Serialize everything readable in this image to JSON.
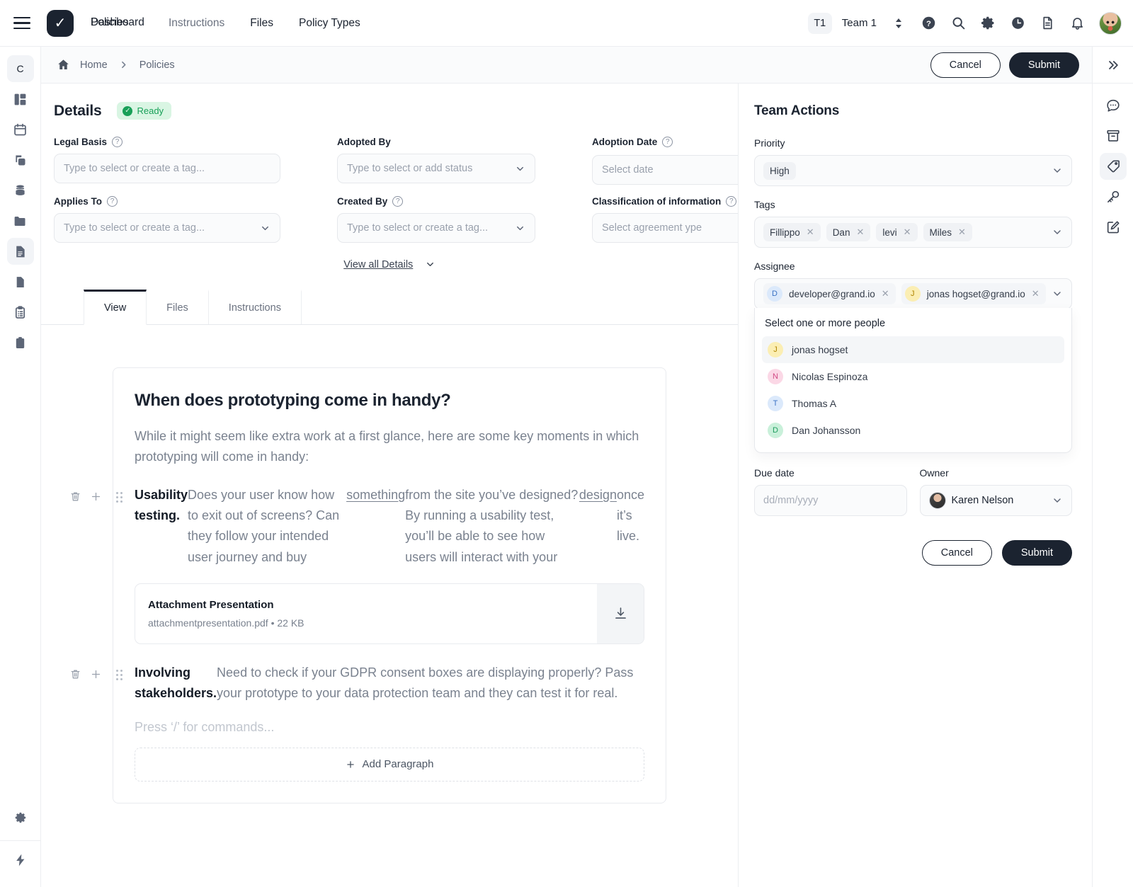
{
  "topbar": {
    "menu_icon": "hamburger-icon",
    "logo_icon": "check-logo",
    "nav": [
      {
        "label": "Dashboard",
        "id": "dashboard"
      },
      {
        "label": "Policies",
        "id": "policies"
      },
      {
        "label": "Instructions",
        "id": "instructions"
      },
      {
        "label": "Files",
        "id": "files"
      },
      {
        "label": "Policy Types",
        "id": "policy-types"
      }
    ],
    "team_badge": "T1",
    "team_name": "Team 1",
    "icons": [
      "updown-selector-icon",
      "help-icon",
      "search-icon",
      "gear-icon",
      "clock-icon",
      "document-icon",
      "bell-icon"
    ],
    "avatar": "user-avatar"
  },
  "breadcrumb": {
    "home_icon": "home-icon",
    "items": [
      "Home",
      "Policies"
    ],
    "cancel_label": "Cancel",
    "submit_label": "Submit"
  },
  "leftrail": {
    "items": [
      {
        "icon": "letter-c",
        "label": "C",
        "active": true
      },
      {
        "icon": "dashboard-grid-icon",
        "active": false
      },
      {
        "icon": "calendar-icon",
        "active": false
      },
      {
        "icon": "copy-icon",
        "active": false
      },
      {
        "icon": "database-icon",
        "active": false
      },
      {
        "icon": "folder-icon",
        "active": false
      },
      {
        "icon": "document-lines-icon",
        "active": true
      },
      {
        "icon": "page-icon",
        "active": false
      },
      {
        "icon": "clipboard-list-icon",
        "active": false
      },
      {
        "icon": "clipboard-icon",
        "active": false
      }
    ],
    "bottom": [
      {
        "icon": "gear-icon"
      },
      {
        "icon": "lightning-icon"
      }
    ]
  },
  "rightrail": {
    "expand_icon": "chevrons-right-icon",
    "items": [
      {
        "icon": "chat-bubble-icon",
        "active": false
      },
      {
        "icon": "archive-box-icon",
        "active": false
      },
      {
        "icon": "tag-icon",
        "active": true
      },
      {
        "icon": "key-icon",
        "active": false
      },
      {
        "icon": "edit-square-icon",
        "active": false
      }
    ]
  },
  "details": {
    "title": "Details",
    "status_badge": "Ready",
    "status_color": "#18a058",
    "fields": [
      {
        "label": "Legal Basis",
        "help": true,
        "placeholder": "Type to select or create a tag...",
        "chevron": false
      },
      {
        "label": "Adopted By",
        "help": false,
        "placeholder": "Type to select or add status",
        "chevron": true
      },
      {
        "label": "Adoption Date",
        "help": true,
        "placeholder": "Select date",
        "chevron": true
      },
      {
        "label": "Applies To",
        "help": true,
        "placeholder": "Type to select or create a tag...",
        "chevron": true
      },
      {
        "label": "Created By",
        "help": true,
        "placeholder": "Type to select or create a tag...",
        "chevron": true
      },
      {
        "label": "Classification of information",
        "help": true,
        "placeholder": "Select agreement ype",
        "chevron": true
      }
    ],
    "view_all": "View all Details"
  },
  "tabs": [
    {
      "label": "View",
      "active": true
    },
    {
      "label": "Files",
      "active": false
    },
    {
      "label": "Instructions",
      "active": false
    }
  ],
  "document": {
    "heading": "When does prototyping come in handy?",
    "lead": "While it might seem like extra work at a first glance, here are some key moments in which prototyping will come in handy:",
    "block1": {
      "bold": "Usability testing.",
      "part1": " Does your user know how to exit out of screens? Can they follow your intended user journey and buy ",
      "link1": "something",
      "part2": " from the site you’ve designed? By running a usability test, you’ll be able to see how users will interact with your ",
      "link2": "design",
      "part3": " once it’s live."
    },
    "attachment": {
      "name": "Attachment Presentation",
      "filename": "attachmentpresentation.pdf",
      "size": "22 KB",
      "separator": "•",
      "download_icon": "download-icon"
    },
    "block2": {
      "bold": "Involving stakeholders.",
      "text": " Need to check if your GDPR consent boxes are displaying properly? Pass your prototype to your data protection team and they can test it for real."
    },
    "editor_placeholder": "Press ‘/’ for commands...",
    "add_paragraph": "Add Paragraph"
  },
  "team_actions": {
    "title": "Team Actions",
    "priority": {
      "label": "Priority",
      "value": "High"
    },
    "tags": {
      "label": "Tags",
      "values": [
        "Fillippo",
        "Dan",
        "levi",
        "Miles"
      ]
    },
    "assignee": {
      "label": "Assignee",
      "selected": [
        {
          "name": "developer@grand.io",
          "initial": "D",
          "color": "blue"
        },
        {
          "name": "jonas hogset@grand.io",
          "initial": "J",
          "color": "yellow"
        }
      ],
      "dropdown_title": "Select one or more people",
      "options": [
        {
          "name": "jonas hogset",
          "initial": "J",
          "color": "yellow",
          "highlighted": true
        },
        {
          "name": "Nicolas Espinoza",
          "initial": "N",
          "color": "pink",
          "highlighted": false
        },
        {
          "name": "Thomas A",
          "initial": "T",
          "color": "blue",
          "highlighted": false
        },
        {
          "name": "Dan Johansson",
          "initial": "D",
          "color": "green",
          "highlighted": false
        }
      ]
    },
    "due_date": {
      "label": "Due date",
      "placeholder": "dd/mm/yyyy"
    },
    "owner": {
      "label": "Owner",
      "value": "Karen Nelson"
    },
    "cancel_label": "Cancel",
    "submit_label": "Submit"
  }
}
